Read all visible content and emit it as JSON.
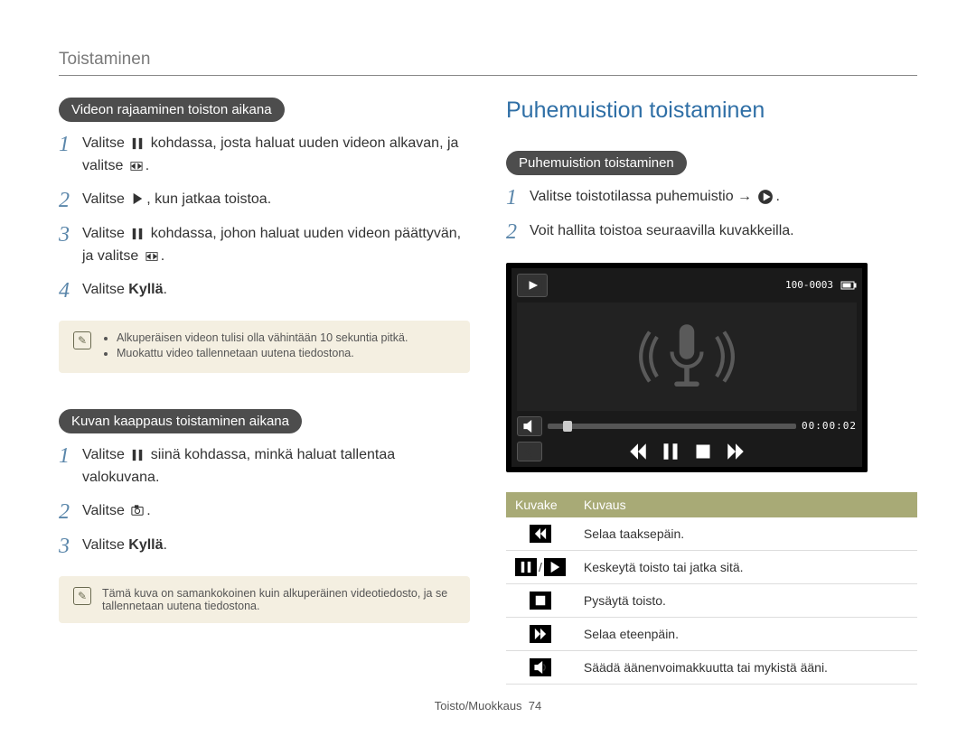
{
  "page": {
    "section": "Toistaminen",
    "footer_label": "Toisto/Muokkaus",
    "footer_page": "74"
  },
  "left": {
    "block1": {
      "pill": "Videon rajaaminen toiston aikana",
      "steps": [
        {
          "n": "1",
          "pre": "Valitse ",
          "mid": " kohdassa, josta haluat uuden videon alkavan, ja valitse ",
          "post": "."
        },
        {
          "n": "2",
          "pre": "Valitse ",
          "mid": ", kun jatkaa toistoa.",
          "post": ""
        },
        {
          "n": "3",
          "pre": "Valitse ",
          "mid": " kohdassa, johon haluat uuden videon päättyvän, ja valitse ",
          "post": "."
        },
        {
          "n": "4",
          "pre": "Valitse ",
          "bold": "Kyllä",
          "post": "."
        }
      ],
      "note": [
        "Alkuperäisen videon tulisi olla vähintään 10 sekuntia pitkä.",
        "Muokattu video tallennetaan uutena tiedostona."
      ]
    },
    "block2": {
      "pill": "Kuvan kaappaus toistaminen aikana",
      "steps": [
        {
          "n": "1",
          "pre": "Valitse ",
          "mid": " siinä kohdassa, minkä haluat tallentaa valokuvana.",
          "post": ""
        },
        {
          "n": "2",
          "pre": "Valitse ",
          "mid": ".",
          "post": ""
        },
        {
          "n": "3",
          "pre": "Valitse ",
          "bold": "Kyllä",
          "post": "."
        }
      ],
      "note_single": "Tämä kuva on samankokoinen kuin alkuperäinen videotiedosto, ja se tallennetaan uutena tiedostona."
    }
  },
  "right": {
    "heading": "Puhemuistion toistaminen",
    "pill": "Puhemuistion toistaminen",
    "steps": [
      {
        "n": "1",
        "pre": "Valitse toistotilassa puhemuistio → ",
        "post": "."
      },
      {
        "n": "2",
        "pre": "Voit hallita toistoa seuraavilla kuvakkeilla.",
        "post": ""
      }
    ],
    "device": {
      "folder": "100-0003",
      "time": "00:00:02"
    },
    "table": {
      "h1": "Kuvake",
      "h2": "Kuvaus",
      "rows": [
        {
          "icon": "rewind",
          "text": "Selaa taaksepäin."
        },
        {
          "icon": "pauseplay",
          "text": "Keskeytä toisto tai jatka sitä."
        },
        {
          "icon": "stop",
          "text": "Pysäytä toisto."
        },
        {
          "icon": "forward",
          "text": "Selaa eteenpäin."
        },
        {
          "icon": "volume",
          "text": "Säädä äänenvoimakkuutta tai mykistä ääni."
        }
      ]
    }
  }
}
